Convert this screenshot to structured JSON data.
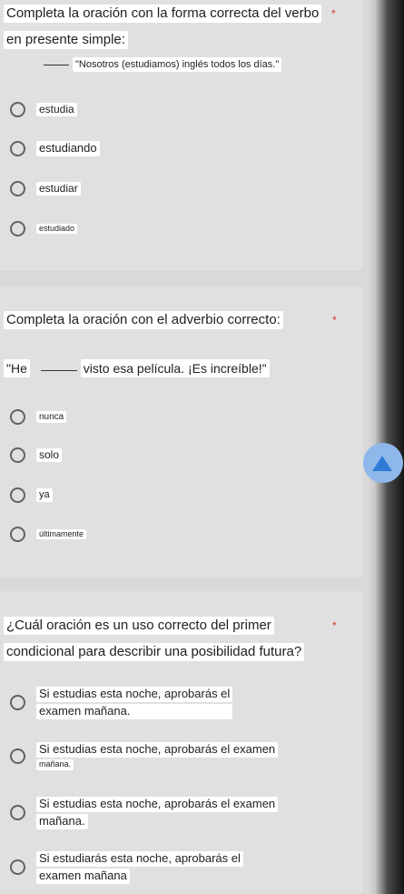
{
  "q1": {
    "title_line1": "Completa la oración con la forma correcta del verbo",
    "title_line2": "en presente simple:",
    "prompt": "\"Nosotros (estudiamos) inglés todos los días.\"",
    "options": [
      "estudia",
      "estudiando",
      "estudiar",
      "estudiado"
    ]
  },
  "q2": {
    "title": "Completa la oración con el adverbio correcto:",
    "prompt_start": "\"He",
    "prompt_end": "visto esa película. ¡Es increíble!\"",
    "options": [
      "nunca",
      "solo",
      "ya",
      "últimamente"
    ]
  },
  "q3": {
    "title_line1": "¿Cuál oración es un uso correcto del primer",
    "title_line2": "condicional para describir una posibilidad futura?",
    "options": [
      {
        "line1": "Si estudias esta noche, aprobarás el",
        "line2": "examen mañana."
      },
      {
        "line1": "Si estudias esta noche, aprobarás el examen",
        "line2": "mañana."
      },
      {
        "line1": "Si estudias esta noche, aprobarás el examen",
        "line2": "mañana."
      },
      {
        "line1": "Si estudiarás esta noche, aprobarás el",
        "line2": "examen mañana"
      }
    ]
  },
  "required_marker": "*",
  "colors": {
    "accent": "#2f7ad6",
    "required": "#d93025"
  },
  "icons": {
    "radio": "radio-button-icon",
    "fab": "triangle-icon"
  }
}
